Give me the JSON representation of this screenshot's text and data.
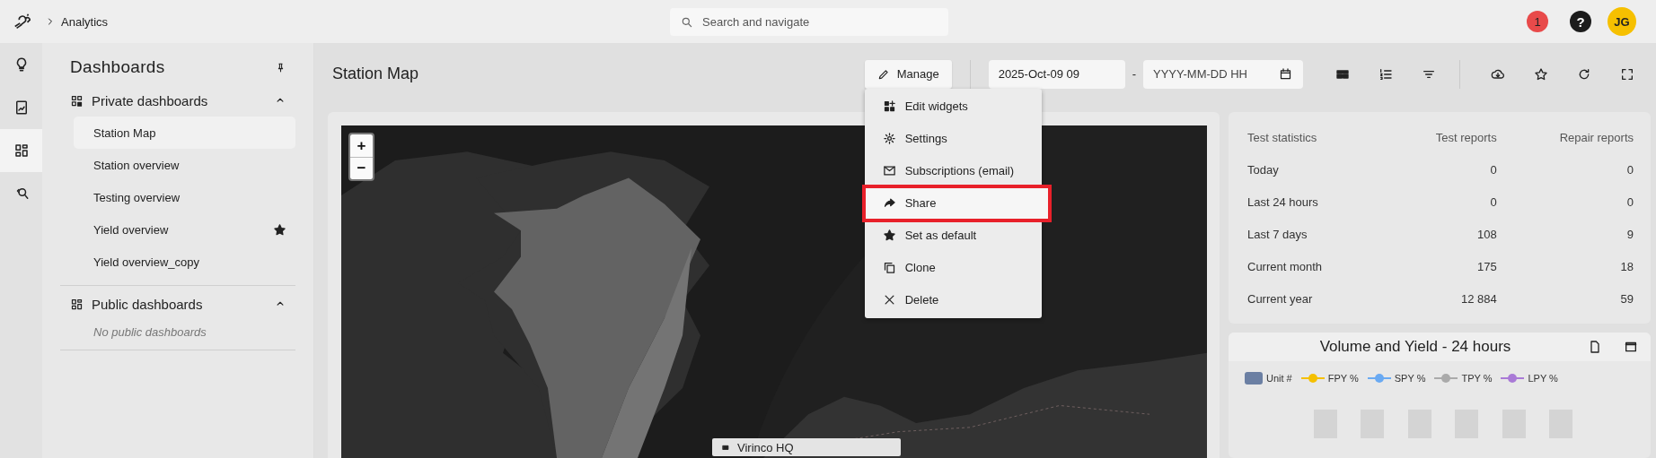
{
  "topbar": {
    "breadcrumb": "Analytics",
    "search": {
      "placeholder": "Search and navigate"
    },
    "notification_count": "1",
    "help": "?",
    "avatar": "JG"
  },
  "rail": [
    {
      "kind": "bulb",
      "selected": false
    },
    {
      "kind": "report",
      "selected": false
    },
    {
      "kind": "dashboards",
      "selected": true
    },
    {
      "kind": "search",
      "selected": false
    }
  ],
  "sidebar": {
    "title": "Dashboards",
    "sections": [
      {
        "title": "Private dashboards",
        "kind": "private",
        "expanded": true,
        "items": [
          {
            "label": "Station Map",
            "selected": true,
            "starred": false
          },
          {
            "label": "Station overview",
            "selected": false,
            "starred": false
          },
          {
            "label": "Testing overview",
            "selected": false,
            "starred": false
          },
          {
            "label": "Yield overview",
            "selected": false,
            "starred": true
          },
          {
            "label": "Yield overview_copy",
            "selected": false,
            "starred": false
          }
        ]
      },
      {
        "title": "Public dashboards",
        "kind": "public",
        "expanded": true,
        "empty_text": "No public dashboards"
      }
    ]
  },
  "page": {
    "title": "Station Map",
    "manage": {
      "label": "Manage",
      "menu": [
        {
          "label": "Edit widgets",
          "kind": "widgets",
          "highlighted": false
        },
        {
          "label": "Settings",
          "kind": "gear",
          "highlighted": false
        },
        {
          "label": "Subscriptions (email)",
          "kind": "mail",
          "highlighted": false
        },
        {
          "label": "Share",
          "kind": "share",
          "highlighted": true
        },
        {
          "label": "Set as default",
          "kind": "star",
          "highlighted": false
        },
        {
          "label": "Clone",
          "kind": "copy",
          "highlighted": false
        },
        {
          "label": "Delete",
          "kind": "close",
          "highlighted": false
        }
      ]
    },
    "date_from": {
      "value": "2025-Oct-09 09"
    },
    "date_separator": "-",
    "date_to": {
      "placeholder": "YYYY-MM-DD HH"
    },
    "toolbar": [
      {
        "kind": "layout"
      },
      {
        "kind": "list"
      },
      {
        "kind": "filter"
      },
      {
        "kind": "divider"
      },
      {
        "kind": "download"
      },
      {
        "kind": "star"
      },
      {
        "kind": "refresh"
      },
      {
        "kind": "fullscreen"
      }
    ]
  },
  "map": {
    "zoom_in": "+",
    "zoom_out": "−",
    "marker_label": "Virinco HQ"
  },
  "stats": {
    "columns": [
      "Test statistics",
      "Test reports",
      "Repair reports"
    ],
    "rows": [
      [
        "Today",
        "0",
        "0"
      ],
      [
        "Last 24 hours",
        "0",
        "0"
      ],
      [
        "Last 7 days",
        "108",
        "9"
      ],
      [
        "Current month",
        "175",
        "18"
      ],
      [
        "Current year",
        "12 884",
        "59"
      ]
    ]
  },
  "chart_widget": {
    "title": "Volume and Yield - 24 hours",
    "legend": [
      {
        "label": "Unit #",
        "kind": "bar",
        "color": "#6b7fa3"
      },
      {
        "label": "FPY %",
        "kind": "line",
        "color": "#f5c000"
      },
      {
        "label": "SPY %",
        "kind": "line",
        "color": "#6aaaf2"
      },
      {
        "label": "TPY %",
        "kind": "line",
        "color": "#aaaaaa"
      },
      {
        "label": "LPY %",
        "kind": "line",
        "color": "#a97ad6"
      }
    ]
  }
}
